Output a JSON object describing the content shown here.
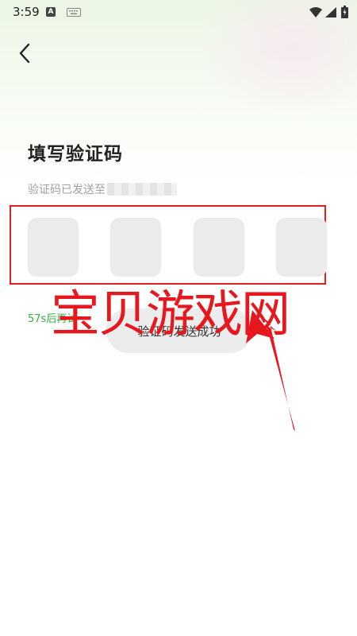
{
  "status_bar": {
    "time": "3:59",
    "notification_badge": "A"
  },
  "header": {
    "title": "填写验证码",
    "subtitle": "验证码已发送至"
  },
  "code_inputs": [
    {
      "value": ""
    },
    {
      "value": ""
    },
    {
      "value": ""
    },
    {
      "value": ""
    }
  ],
  "resend": {
    "countdown_text": "57s后再试"
  },
  "toast": {
    "message": "验证码发送成功"
  },
  "watermark": {
    "text": "宝贝游戏网"
  },
  "colors": {
    "accent_green": "#2fae3e",
    "highlight_red": "#e02020",
    "watermark_red": "#e8161d"
  }
}
